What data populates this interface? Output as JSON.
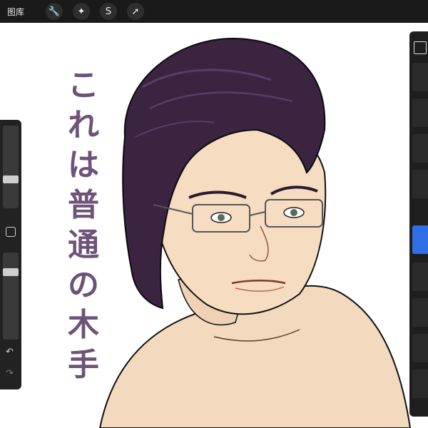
{
  "topbar": {
    "gallery_label": "图库",
    "tools": [
      {
        "name": "wrench-icon",
        "glyph": "🔧"
      },
      {
        "name": "magic-wand-icon",
        "glyph": "✦"
      },
      {
        "name": "selection-s-icon",
        "glyph": "S"
      },
      {
        "name": "arrow-icon",
        "glyph": "➚"
      }
    ]
  },
  "canvas": {
    "calligraphy": [
      "こ",
      "れ",
      "は",
      "普",
      "通",
      "の",
      "木",
      "手"
    ]
  },
  "sidebar": {
    "undo_glyph": "↶",
    "redo_glyph": "↷"
  },
  "colors": {
    "topbar": "#1a1a1a",
    "panel": "#222222",
    "accent_blue": "#2f6ee5",
    "hair": "#3a2440",
    "skin": "#f3d9bd",
    "calligraphy": "#6e5378"
  }
}
